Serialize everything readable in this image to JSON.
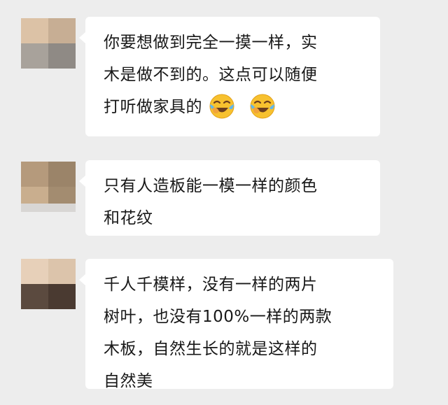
{
  "messages": [
    {
      "lines": [
        "你要想做到完全一摸一样，实",
        "木是做不到的。这点可以随便",
        "打听做家具的"
      ],
      "emojis": [
        "face-with-tears-of-joy-icon",
        "face-with-tears-of-joy-icon"
      ]
    },
    {
      "lines": [
        "只有人造板能一模一样的颜色",
        "和花纹"
      ]
    },
    {
      "lines": [
        "千人千模样，没有一样的两片",
        "树叶，也没有100%一样的两款",
        "木板，自然生长的就是这样的",
        "自然美"
      ]
    }
  ],
  "colors": {
    "background": "#ededed",
    "bubble": "#ffffff",
    "text": "#181818",
    "emoji": "#f7c12f"
  }
}
